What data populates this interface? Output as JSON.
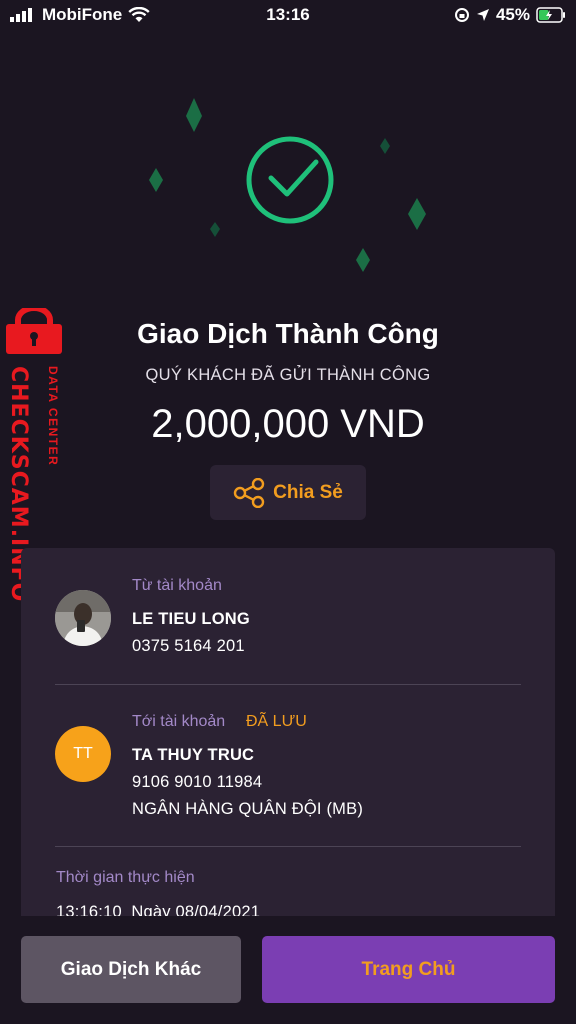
{
  "status_bar": {
    "carrier": "MobiFone",
    "time": "13:16",
    "battery_percent": "45%",
    "battery_level": 0.45
  },
  "watermark": {
    "main": "CHECKSCAM.INFO",
    "sub": "DATA CENTER"
  },
  "header": {
    "title": "Giao Dịch Thành Công",
    "subtitle": "QUÝ KHÁCH ĐÃ GỬI THÀNH CÔNG",
    "amount": "2,000,000 VND"
  },
  "share": {
    "label": "Chia Sẻ"
  },
  "from": {
    "label": "Từ tài khoản",
    "name": "LE TIEU LONG",
    "account": "0375 5164 201"
  },
  "to": {
    "label": "Tới tài khoản",
    "saved_badge": "ĐÃ LƯU",
    "initials": "TT",
    "name": "TA THUY TRUC",
    "account": "9106 9010 11984",
    "bank": "NGÂN HÀNG QUÂN ĐỘI (MB)"
  },
  "time_section": {
    "label": "Thời gian thực hiện",
    "value": "13:16:10  Ngày 08/04/2021"
  },
  "buttons": {
    "other": "Giao Dịch Khác",
    "home": "Trang Chủ"
  },
  "colors": {
    "background": "#1b1521",
    "card": "#2b2233",
    "accent_orange": "#f29d1f",
    "accent_purple": "#7b3eb3",
    "success_green": "#1fc07a",
    "label_purple": "#a389c8",
    "watermark_red": "#e8191f"
  }
}
